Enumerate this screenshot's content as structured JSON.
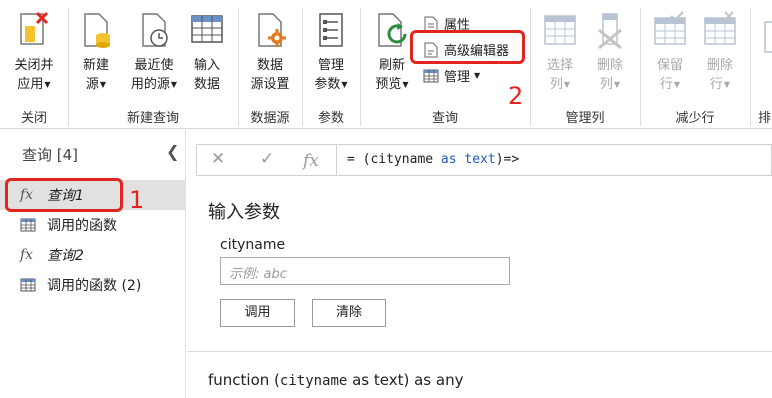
{
  "ribbon": {
    "groups": {
      "close": "关闭",
      "new_query": "新建查询",
      "data_sources": "数据源",
      "parameters": "参数",
      "query": "查询",
      "manage_columns": "管理列",
      "reduce_rows": "减少行",
      "sort_partial": "排"
    },
    "buttons": {
      "close_apply_1": "关闭并",
      "close_apply_2": "应用",
      "new_source_1": "新建",
      "new_source_2": "源",
      "recent_sources_1": "最近使",
      "recent_sources_2": "用的源",
      "enter_data_1": "输入",
      "enter_data_2": "数据",
      "data_source_settings_1": "数据",
      "data_source_settings_2": "源设置",
      "manage_params_1": "管理",
      "manage_params_2": "参数",
      "refresh_preview_1": "刷新",
      "refresh_preview_2": "预览",
      "properties": "属性",
      "advanced_editor": "高级编辑器",
      "manage": "管理",
      "choose_columns_1": "选择",
      "choose_columns_2": "列",
      "remove_columns_1": "删除",
      "remove_columns_2": "列",
      "keep_rows_1": "保留",
      "keep_rows_2": "行",
      "remove_rows_1": "删除",
      "remove_rows_2": "行"
    }
  },
  "queries_pane": {
    "title": "查询 [4]",
    "items": [
      {
        "label": "查询1",
        "type": "function"
      },
      {
        "label": "调用的函数",
        "type": "table"
      },
      {
        "label": "查询2",
        "type": "function"
      },
      {
        "label": "调用的函数 (2)",
        "type": "table"
      }
    ]
  },
  "formula_bar": {
    "cancel": "✕",
    "commit": "✓",
    "fx": "fx",
    "prefix": "= (cityname ",
    "kw_as": "as",
    "kw_text": "text",
    "suffix": ")=>"
  },
  "main": {
    "heading": "输入参数",
    "param_label": "cityname",
    "param_placeholder": "示例: abc",
    "invoke_button": "调用",
    "clear_button": "清除",
    "signature_prefix": "function (",
    "signature_param": "cityname",
    "signature_suffix": " as text) as any"
  },
  "annotations": {
    "num1": "1",
    "num2": "2"
  },
  "colors": {
    "annotation": "#e3251f",
    "selected_item": "#e1e1e1",
    "accent_blue": "#1e5bb8",
    "orange": "#e07b21"
  }
}
